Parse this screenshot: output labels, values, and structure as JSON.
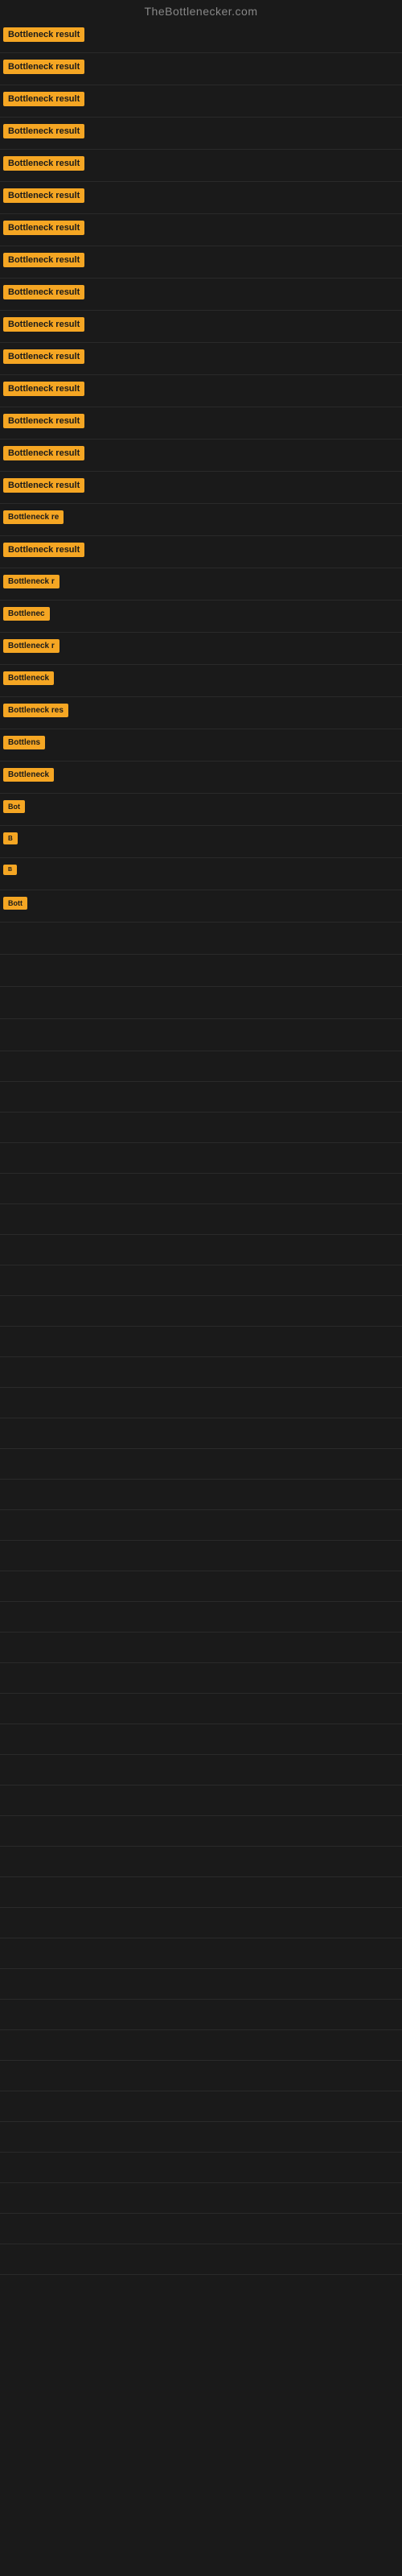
{
  "site": {
    "title": "TheBottlenecker.com"
  },
  "badge_label": "Bottleneck result",
  "items": [
    {
      "id": 1,
      "badge": "Bottleneck result",
      "desc": ""
    },
    {
      "id": 2,
      "badge": "Bottleneck result",
      "desc": ""
    },
    {
      "id": 3,
      "badge": "Bottleneck result",
      "desc": ""
    },
    {
      "id": 4,
      "badge": "Bottleneck result",
      "desc": ""
    },
    {
      "id": 5,
      "badge": "Bottleneck result",
      "desc": ""
    },
    {
      "id": 6,
      "badge": "Bottleneck result",
      "desc": ""
    },
    {
      "id": 7,
      "badge": "Bottleneck result",
      "desc": ""
    },
    {
      "id": 8,
      "badge": "Bottleneck result",
      "desc": ""
    },
    {
      "id": 9,
      "badge": "Bottleneck result",
      "desc": ""
    },
    {
      "id": 10,
      "badge": "Bottleneck result",
      "desc": ""
    },
    {
      "id": 11,
      "badge": "Bottleneck result",
      "desc": ""
    },
    {
      "id": 12,
      "badge": "Bottleneck result",
      "desc": ""
    },
    {
      "id": 13,
      "badge": "Bottleneck result",
      "desc": ""
    },
    {
      "id": 14,
      "badge": "Bottleneck result",
      "desc": ""
    },
    {
      "id": 15,
      "badge": "Bottleneck result",
      "desc": ""
    },
    {
      "id": 16,
      "badge": "Bottleneck re",
      "desc": ""
    },
    {
      "id": 17,
      "badge": "Bottleneck result",
      "desc": ""
    },
    {
      "id": 18,
      "badge": "Bottleneck r",
      "desc": ""
    },
    {
      "id": 19,
      "badge": "Bottlenec",
      "desc": ""
    },
    {
      "id": 20,
      "badge": "Bottleneck r",
      "desc": ""
    },
    {
      "id": 21,
      "badge": "Bottleneck",
      "desc": ""
    },
    {
      "id": 22,
      "badge": "Bottleneck res",
      "desc": ""
    },
    {
      "id": 23,
      "badge": "Bottlens",
      "desc": ""
    },
    {
      "id": 24,
      "badge": "Bottleneck",
      "desc": ""
    },
    {
      "id": 25,
      "badge": "Bot",
      "desc": ""
    },
    {
      "id": 26,
      "badge": "B",
      "desc": ""
    },
    {
      "id": 27,
      "badge": "B",
      "desc": ""
    },
    {
      "id": 28,
      "badge": "Bott",
      "desc": ""
    },
    {
      "id": 29,
      "badge": "",
      "desc": ""
    },
    {
      "id": 30,
      "badge": "",
      "desc": ""
    },
    {
      "id": 31,
      "badge": "",
      "desc": ""
    },
    {
      "id": 32,
      "badge": "",
      "desc": ""
    }
  ]
}
